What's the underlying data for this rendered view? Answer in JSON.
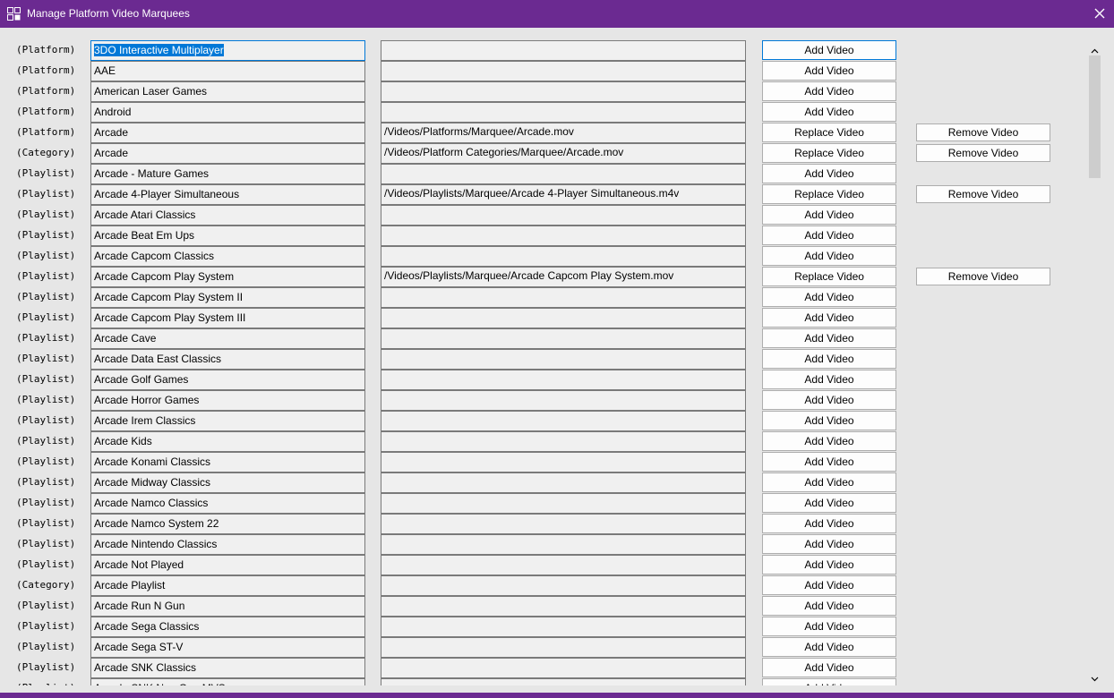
{
  "window": {
    "title": "Manage Platform Video Marquees"
  },
  "rows": [
    {
      "type": "(Platform)",
      "name": "3DO Interactive Multiplayer",
      "path": "",
      "action": "Add Video",
      "remove": ""
    },
    {
      "type": "(Platform)",
      "name": "AAE",
      "path": "",
      "action": "Add Video",
      "remove": ""
    },
    {
      "type": "(Platform)",
      "name": "American Laser Games",
      "path": "",
      "action": "Add Video",
      "remove": ""
    },
    {
      "type": "(Platform)",
      "name": "Android",
      "path": "",
      "action": "Add Video",
      "remove": ""
    },
    {
      "type": "(Platform)",
      "name": "Arcade",
      "path": "/Videos/Platforms/Marquee/Arcade.mov",
      "action": "Replace Video",
      "remove": "Remove Video"
    },
    {
      "type": "(Category)",
      "name": "Arcade",
      "path": "/Videos/Platform Categories/Marquee/Arcade.mov",
      "action": "Replace Video",
      "remove": "Remove Video"
    },
    {
      "type": "(Playlist)",
      "name": "Arcade - Mature Games",
      "path": "",
      "action": "Add Video",
      "remove": ""
    },
    {
      "type": "(Playlist)",
      "name": "Arcade 4-Player Simultaneous",
      "path": "/Videos/Playlists/Marquee/Arcade 4-Player Simultaneous.m4v",
      "action": "Replace Video",
      "remove": "Remove Video"
    },
    {
      "type": "(Playlist)",
      "name": "Arcade Atari Classics",
      "path": "",
      "action": "Add Video",
      "remove": ""
    },
    {
      "type": "(Playlist)",
      "name": "Arcade Beat Em Ups",
      "path": "",
      "action": "Add Video",
      "remove": ""
    },
    {
      "type": "(Playlist)",
      "name": "Arcade Capcom Classics",
      "path": "",
      "action": "Add Video",
      "remove": ""
    },
    {
      "type": "(Playlist)",
      "name": "Arcade Capcom Play System",
      "path": "/Videos/Playlists/Marquee/Arcade Capcom Play System.mov",
      "action": "Replace Video",
      "remove": "Remove Video"
    },
    {
      "type": "(Playlist)",
      "name": "Arcade Capcom Play System II",
      "path": "",
      "action": "Add Video",
      "remove": ""
    },
    {
      "type": "(Playlist)",
      "name": "Arcade Capcom Play System III",
      "path": "",
      "action": "Add Video",
      "remove": ""
    },
    {
      "type": "(Playlist)",
      "name": "Arcade Cave",
      "path": "",
      "action": "Add Video",
      "remove": ""
    },
    {
      "type": "(Playlist)",
      "name": "Arcade Data East Classics",
      "path": "",
      "action": "Add Video",
      "remove": ""
    },
    {
      "type": "(Playlist)",
      "name": "Arcade Golf Games",
      "path": "",
      "action": "Add Video",
      "remove": ""
    },
    {
      "type": "(Playlist)",
      "name": "Arcade Horror Games",
      "path": "",
      "action": "Add Video",
      "remove": ""
    },
    {
      "type": "(Playlist)",
      "name": "Arcade Irem Classics",
      "path": "",
      "action": "Add Video",
      "remove": ""
    },
    {
      "type": "(Playlist)",
      "name": "Arcade Kids",
      "path": "",
      "action": "Add Video",
      "remove": ""
    },
    {
      "type": "(Playlist)",
      "name": "Arcade Konami Classics",
      "path": "",
      "action": "Add Video",
      "remove": ""
    },
    {
      "type": "(Playlist)",
      "name": "Arcade Midway Classics",
      "path": "",
      "action": "Add Video",
      "remove": ""
    },
    {
      "type": "(Playlist)",
      "name": "Arcade Namco Classics",
      "path": "",
      "action": "Add Video",
      "remove": ""
    },
    {
      "type": "(Playlist)",
      "name": "Arcade Namco System 22",
      "path": "",
      "action": "Add Video",
      "remove": ""
    },
    {
      "type": "(Playlist)",
      "name": "Arcade Nintendo Classics",
      "path": "",
      "action": "Add Video",
      "remove": ""
    },
    {
      "type": "(Playlist)",
      "name": "Arcade Not Played",
      "path": "",
      "action": "Add Video",
      "remove": ""
    },
    {
      "type": "(Category)",
      "name": "Arcade Playlist",
      "path": "",
      "action": "Add Video",
      "remove": ""
    },
    {
      "type": "(Playlist)",
      "name": "Arcade Run N Gun",
      "path": "",
      "action": "Add Video",
      "remove": ""
    },
    {
      "type": "(Playlist)",
      "name": "Arcade Sega Classics",
      "path": "",
      "action": "Add Video",
      "remove": ""
    },
    {
      "type": "(Playlist)",
      "name": "Arcade Sega ST-V",
      "path": "",
      "action": "Add Video",
      "remove": ""
    },
    {
      "type": "(Playlist)",
      "name": "Arcade SNK Classics",
      "path": "",
      "action": "Add Video",
      "remove": ""
    },
    {
      "type": "(Playlist)",
      "name": "Arcade SNK Neo Geo MVS",
      "path": "",
      "action": "Add Video",
      "remove": ""
    }
  ],
  "icons": {
    "app": "marquee-app-icon",
    "close": "close-icon",
    "up": "scroll-up-icon",
    "down": "scroll-down-icon"
  },
  "colors": {
    "titlebar": "#6b2a91",
    "focus": "#0078d7"
  }
}
